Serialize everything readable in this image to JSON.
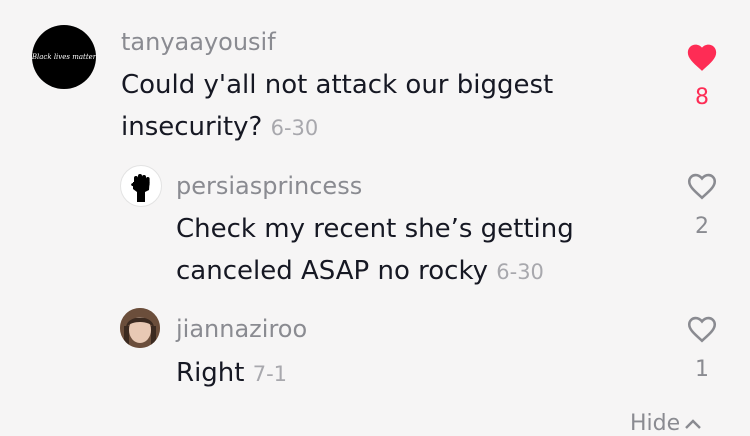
{
  "comments": [
    {
      "username": "tanyaayousif",
      "text_line1": "Could y'all not attack our biggest",
      "text_line2": "insecurity?",
      "date": "6-30",
      "likes": "8",
      "liked": true,
      "avatar_text": "Black lives matter",
      "avatar_icon": "black-avatar-with-text"
    },
    {
      "username": "persiasprincess",
      "text_line1": "Check my recent she’s getting",
      "text_line2": "canceled ASAP no rocky",
      "date": "6-30",
      "likes": "2",
      "liked": false,
      "avatar_icon": "raised-fist-icon"
    },
    {
      "username": "jiannaziroo",
      "text_line1": "Right",
      "date": "7-1",
      "likes": "1",
      "liked": false,
      "avatar_icon": "user-photo"
    }
  ],
  "hide_label": "Hide",
  "colors": {
    "background": "#f6f5f5",
    "text": "#161823",
    "secondary": "#8a8b91",
    "like_active": "#fe2c55"
  }
}
